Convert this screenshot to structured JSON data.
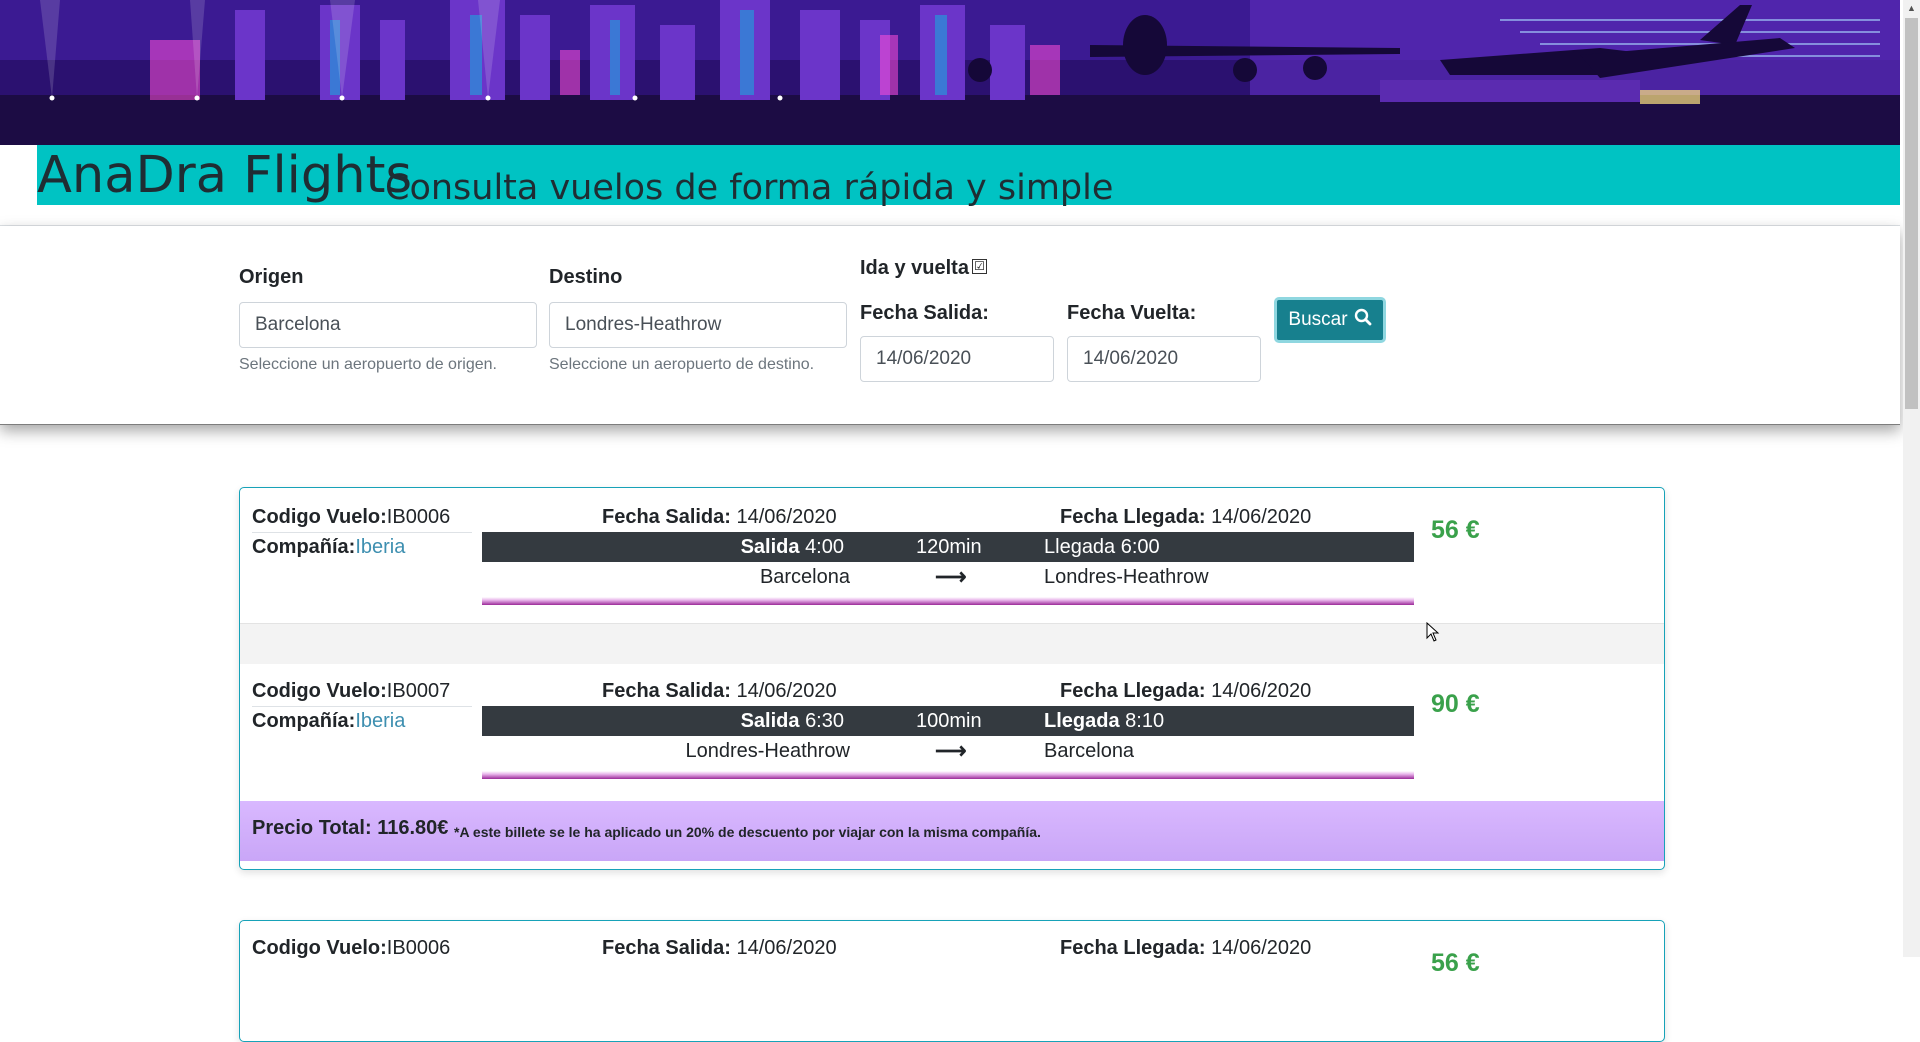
{
  "header": {
    "brand": "AnaDra Flights",
    "tagline": "Consulta vuelos de forma rápida y simple"
  },
  "search": {
    "origin_label": "Origen",
    "origin_value": "Barcelona",
    "origin_hint": "Seleccione un aeropuerto de origen.",
    "dest_label": "Destino",
    "dest_value": "Londres-Heathrow",
    "dest_hint": "Seleccione un aeropuerto de destino.",
    "roundtrip_label": "Ida y vuelta",
    "roundtrip_checked": true,
    "roundtrip_mark": "☑",
    "dep_date_label": "Fecha Salida:",
    "dep_date_value": "14/06/2020",
    "ret_date_label": "Fecha Vuelta:",
    "ret_date_value": "14/06/2020",
    "button_label": "Buscar",
    "button_icon": "search-icon"
  },
  "labels": {
    "code": "Codigo Vuelo:",
    "company": "Compañía:",
    "dep_date": "Fecha Salida:",
    "arr_date": "Fecha Llegada:",
    "departure": "Salida",
    "arrival": "Llegada",
    "arrow": "⟶"
  },
  "results": [
    {
      "outbound": {
        "code": "IB0006",
        "company": "Iberia",
        "dep_date": "14/06/2020",
        "arr_date": "14/06/2020",
        "dep_time": "4:00",
        "duration": "120min",
        "arr_time": "6:00",
        "origin": "Barcelona",
        "destination": "Londres-Heathrow",
        "price": "56 €"
      },
      "return": {
        "code": "IB0007",
        "company": "Iberia",
        "dep_date": "14/06/2020",
        "arr_date": "14/06/2020",
        "dep_time": "6:30",
        "duration": "100min",
        "arr_time": "8:10",
        "origin": "Londres-Heathrow",
        "destination": "Barcelona",
        "price": "90 €"
      },
      "total_label": "Precio Total: 116.80€",
      "total_note": "*A este billete se le ha aplicado un 20% de descuento por viajar con la misma compañía."
    },
    {
      "outbound": {
        "code": "IB0006",
        "dep_date": "14/06/2020",
        "arr_date": "14/06/2020",
        "price": "56 €"
      }
    }
  ],
  "colors": {
    "accent": "#00c3c3",
    "button": "#17808e",
    "price": "#3aa14b",
    "dark_bar": "#343a40",
    "total_bar": "#d2b0fc"
  }
}
